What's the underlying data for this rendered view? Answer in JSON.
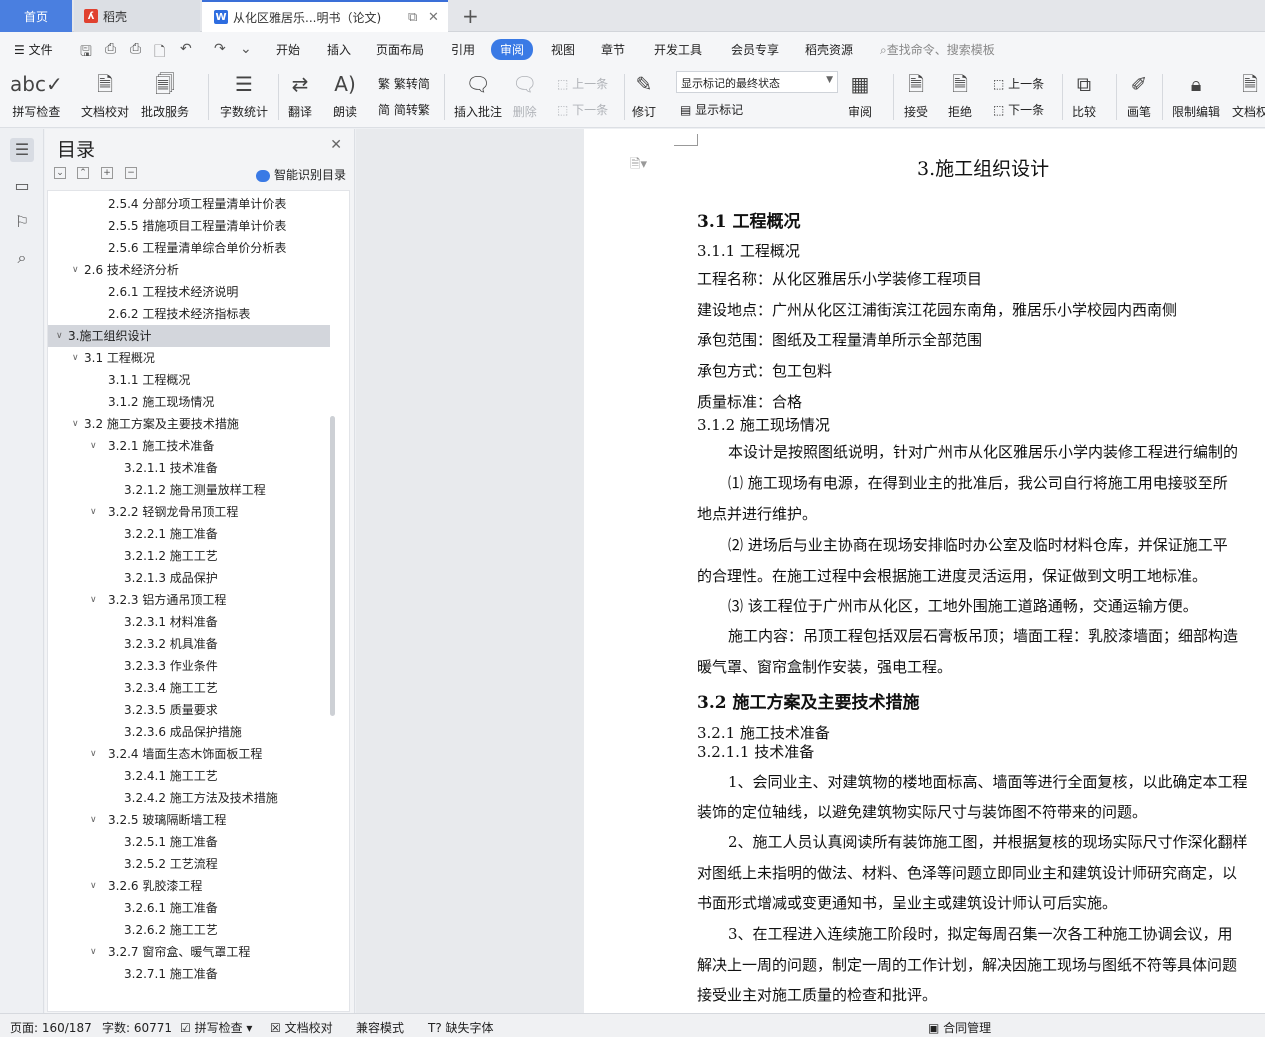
{
  "tabs": {
    "home": "首页",
    "daoke": "稻壳",
    "doc": "从化区雅居乐...明书（论文)"
  },
  "menu": [
    "开始",
    "插入",
    "页面布局",
    "引用",
    "审阅",
    "视图",
    "章节",
    "开发工具",
    "会员专享",
    "稻壳资源"
  ],
  "file_label": "文件",
  "search_placeholder": "查找命令、搜索模板",
  "ribbon": {
    "spell": "拼写检查",
    "proof": "文档校对",
    "batch": "批改服务",
    "wordcount": "字数统计",
    "translate": "翻译",
    "read": "朗读",
    "s2t": "繁转简",
    "t2s": "简转繁",
    "insert_comment": "插入批注",
    "delete": "删除",
    "prev_comment": "上一条",
    "next_comment": "下一条",
    "revise": "修订",
    "markup_select": "显示标记的最终状态",
    "show_markup": "显示标记",
    "review": "审阅",
    "accept": "接受",
    "reject": "拒绝",
    "prev_change": "上一条",
    "next_change": "下一条",
    "compare": "比较",
    "pen": "画笔",
    "restrict": "限制编辑",
    "docpriv": "文档权"
  },
  "toc": {
    "title": "目录",
    "smart": "智能识别目录",
    "items": [
      {
        "level": 3,
        "text": "2.5.4 分部分项工程量清单计价表",
        "chev": false
      },
      {
        "level": 3,
        "text": "2.5.5 措施项目工程量清单计价表",
        "chev": false
      },
      {
        "level": 3,
        "text": "2.5.6 工程量清单综合单价分析表",
        "chev": false
      },
      {
        "level": 2,
        "text": "2.6 技术经济分析",
        "chev": true
      },
      {
        "level": 3,
        "text": "2.6.1 工程技术经济说明",
        "chev": false
      },
      {
        "level": 3,
        "text": "2.6.2 工程技术经济指标表",
        "chev": false
      },
      {
        "level": 1,
        "text": "3.施工组织设计",
        "chev": true,
        "selected": true
      },
      {
        "level": 2,
        "text": "3.1 工程概况",
        "chev": true
      },
      {
        "level": 3,
        "text": "3.1.1 工程概况",
        "chev": false
      },
      {
        "level": 3,
        "text": "3.1.2 施工现场情况",
        "chev": false
      },
      {
        "level": 2,
        "text": "3.2 施工方案及主要技术措施",
        "chev": true
      },
      {
        "level": 3,
        "text": "3.2.1 施工技术准备",
        "chev": true
      },
      {
        "level": 4,
        "text": "3.2.1.1 技术准备",
        "chev": false
      },
      {
        "level": 4,
        "text": "3.2.1.2 施工测量放样工程",
        "chev": false
      },
      {
        "level": 3,
        "text": "3.2.2 轻钢龙骨吊顶工程",
        "chev": true
      },
      {
        "level": 4,
        "text": "3.2.2.1 施工准备",
        "chev": false
      },
      {
        "level": 4,
        "text": "3.2.1.2 施工工艺",
        "chev": false
      },
      {
        "level": 4,
        "text": "3.2.1.3 成品保护",
        "chev": false
      },
      {
        "level": 3,
        "text": "3.2.3 铝方通吊顶工程",
        "chev": true
      },
      {
        "level": 4,
        "text": "3.2.3.1 材料准备",
        "chev": false
      },
      {
        "level": 4,
        "text": "3.2.3.2 机具准备",
        "chev": false
      },
      {
        "level": 4,
        "text": "3.2.3.3 作业条件",
        "chev": false
      },
      {
        "level": 4,
        "text": "3.2.3.4 施工工艺",
        "chev": false
      },
      {
        "level": 4,
        "text": "3.2.3.5 质量要求",
        "chev": false
      },
      {
        "level": 4,
        "text": "3.2.3.6 成品保护措施",
        "chev": false
      },
      {
        "level": 3,
        "text": "3.2.4 墙面生态木饰面板工程",
        "chev": true
      },
      {
        "level": 4,
        "text": "3.2.4.1 施工工艺",
        "chev": false
      },
      {
        "level": 4,
        "text": "3.2.4.2 施工方法及技术措施",
        "chev": false
      },
      {
        "level": 3,
        "text": "3.2.5 玻璃隔断墙工程",
        "chev": true
      },
      {
        "level": 4,
        "text": "3.2.5.1 施工准备",
        "chev": false
      },
      {
        "level": 4,
        "text": "3.2.5.2 工艺流程",
        "chev": false
      },
      {
        "level": 3,
        "text": "3.2.6 乳胶漆工程",
        "chev": true
      },
      {
        "level": 4,
        "text": "3.2.6.1 施工准备",
        "chev": false
      },
      {
        "level": 4,
        "text": "3.2.6.2 施工工艺",
        "chev": false
      },
      {
        "level": 3,
        "text": "3.2.7 窗帘盒、暖气罩工程",
        "chev": true
      },
      {
        "level": 4,
        "text": "3.2.7.1 施工准备",
        "chev": false
      }
    ]
  },
  "doc": {
    "title": "3.施工组织设计",
    "lines": [
      {
        "cls": "h2",
        "text": "3.1 工程概况"
      },
      {
        "cls": "h3",
        "text": "3.1.1 工程概况"
      },
      {
        "cls": "",
        "text": "工程名称：从化区雅居乐小学装修工程项目"
      },
      {
        "cls": "",
        "text": "建设地点：广州从化区江浦街滨江花园东南角，雅居乐小学校园内西南侧"
      },
      {
        "cls": "",
        "text": "承包范围：图纸及工程量清单所示全部范围"
      },
      {
        "cls": "",
        "text": "承包方式：包工包料"
      },
      {
        "cls": "",
        "text": "质量标准：合格"
      },
      {
        "cls": "h3",
        "text": "3.1.2 施工现场情况"
      },
      {
        "cls": "ind",
        "text": "本设计是按照图纸说明，针对广州市从化区雅居乐小学内装修工程进行编制的"
      },
      {
        "cls": "ind",
        "text": "⑴ 施工现场有电源，在得到业主的批准后，我公司自行将施工用电接驳至所"
      },
      {
        "cls": "",
        "text": "地点并进行维护。"
      },
      {
        "cls": "ind",
        "text": "⑵ 进场后与业主协商在现场安排临时办公室及临时材料仓库，并保证施工平"
      },
      {
        "cls": "",
        "text": "的合理性。在施工过程中会根据施工进度灵活运用，保证做到文明工地标准。"
      },
      {
        "cls": "ind",
        "text": "⑶ 该工程位于广州市从化区，工地外围施工道路通畅，交通运输方便。"
      },
      {
        "cls": "ind",
        "text": "施工内容：吊顶工程包括双层石膏板吊顶；墙面工程：乳胶漆墙面；细部构造"
      },
      {
        "cls": "",
        "text": "暖气罩、窗帘盒制作安装，强电工程。"
      },
      {
        "cls": "h2",
        "text": "3.2 施工方案及主要技术措施"
      },
      {
        "cls": "h3",
        "text": "3.2.1 施工技术准备"
      },
      {
        "cls": "h3",
        "text": "3.2.1.1 技术准备"
      },
      {
        "cls": "ind",
        "text": "1、会同业主、对建筑物的楼地面标高、墙面等进行全面复核，以此确定本工程"
      },
      {
        "cls": "",
        "text": "装饰的定位轴线，以避免建筑物实际尺寸与装饰图不符带来的问题。"
      },
      {
        "cls": "ind",
        "text": "2、施工人员认真阅读所有装饰施工图，并根据复核的现场实际尺寸作深化翻样"
      },
      {
        "cls": "",
        "text": "对图纸上未指明的做法、材料、色泽等问题立即同业主和建筑设计师研究商定，以"
      },
      {
        "cls": "",
        "text": "书面形式增减或变更通知书，呈业主或建筑设计师认可后实施。"
      },
      {
        "cls": "ind",
        "text": "3、在工程进入连续施工阶段时，拟定每周召集一次各工种施工协调会议，用"
      },
      {
        "cls": "",
        "text": "解决上一周的问题，制定一周的工作计划，解决因施工现场与图纸不符等具体问题"
      },
      {
        "cls": "",
        "text": "接受业主对施工质量的检查和批评。"
      }
    ]
  },
  "status": {
    "page": "页面: 160/187",
    "words": "字数: 60771",
    "spell": "拼写检查",
    "proof": "文档校对",
    "compat": "兼容模式",
    "missing_font": "缺失字体",
    "contract": "合同管理"
  }
}
